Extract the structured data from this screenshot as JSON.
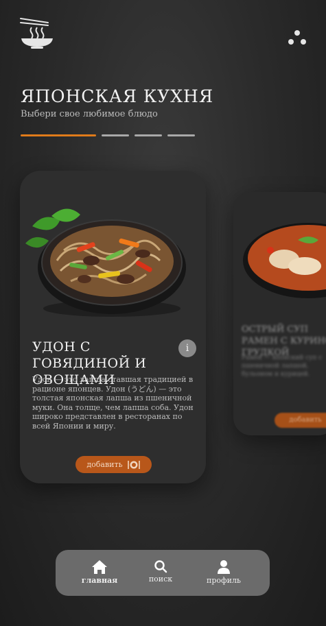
{
  "header": {
    "logo_icon": "noodle-bowl-icon",
    "menu_icon": "three-dots-icon",
    "title": "ЯПОНСКАЯ КУХНЯ",
    "subtitle": "Выбери свое любимое блюдо"
  },
  "carousel": {
    "total_slides": 4,
    "active_slide": 1,
    "active_color": "#e07b1a"
  },
  "main_card": {
    "title": "УДОН С ГОВЯДИНОЙ И ОВОЩАМИ",
    "info_label": "i",
    "description": "Удон — это лапша ставшая традицией в рационе японцев. Удон (うどん) — это толстая японская лапша из пшеничной муки. Она толще, чем лапша соба. Удон широко представлен в ресторанах по всей Японии и миру.",
    "add_label": "добавить",
    "add_icon": "plate-cutlery-icon",
    "accent_color": "#b8571a"
  },
  "next_card": {
    "title": "ОСТРЫЙ СУП РАМЕН С КУРИНОЙ ГРУДКОЙ",
    "description": "Рамен — японский суп с пшеничной лапшой, бульоном и курицей.",
    "add_label": "добавить"
  },
  "nav": {
    "items": [
      {
        "label": "главная",
        "icon": "home-icon"
      },
      {
        "label": "поиск",
        "icon": "search-icon"
      },
      {
        "label": "профиль",
        "icon": "user-icon"
      }
    ]
  }
}
